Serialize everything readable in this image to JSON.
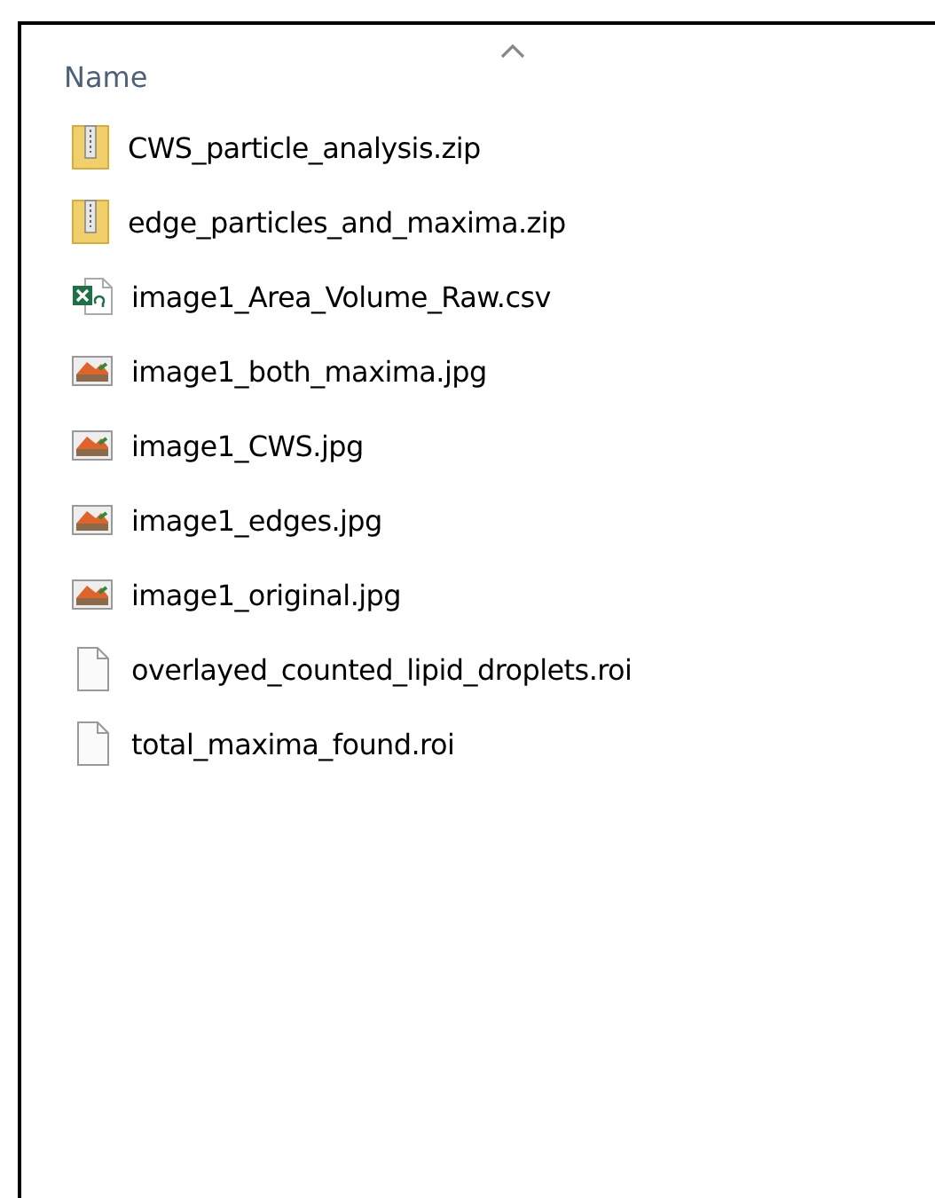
{
  "header": {
    "column": "Name"
  },
  "files": [
    {
      "name": "CWS_particle_analysis.zip",
      "kind": "zip"
    },
    {
      "name": "edge_particles_and_maxima.zip",
      "kind": "zip"
    },
    {
      "name": "image1_Area_Volume_Raw.csv",
      "kind": "csv"
    },
    {
      "name": "image1_both_maxima.jpg",
      "kind": "image"
    },
    {
      "name": "image1_CWS.jpg",
      "kind": "image"
    },
    {
      "name": "image1_edges.jpg",
      "kind": "image"
    },
    {
      "name": "image1_original.jpg",
      "kind": "image"
    },
    {
      "name": "overlayed_counted_lipid_droplets.roi",
      "kind": "file"
    },
    {
      "name": "total_maxima_found.roi",
      "kind": "file"
    }
  ]
}
